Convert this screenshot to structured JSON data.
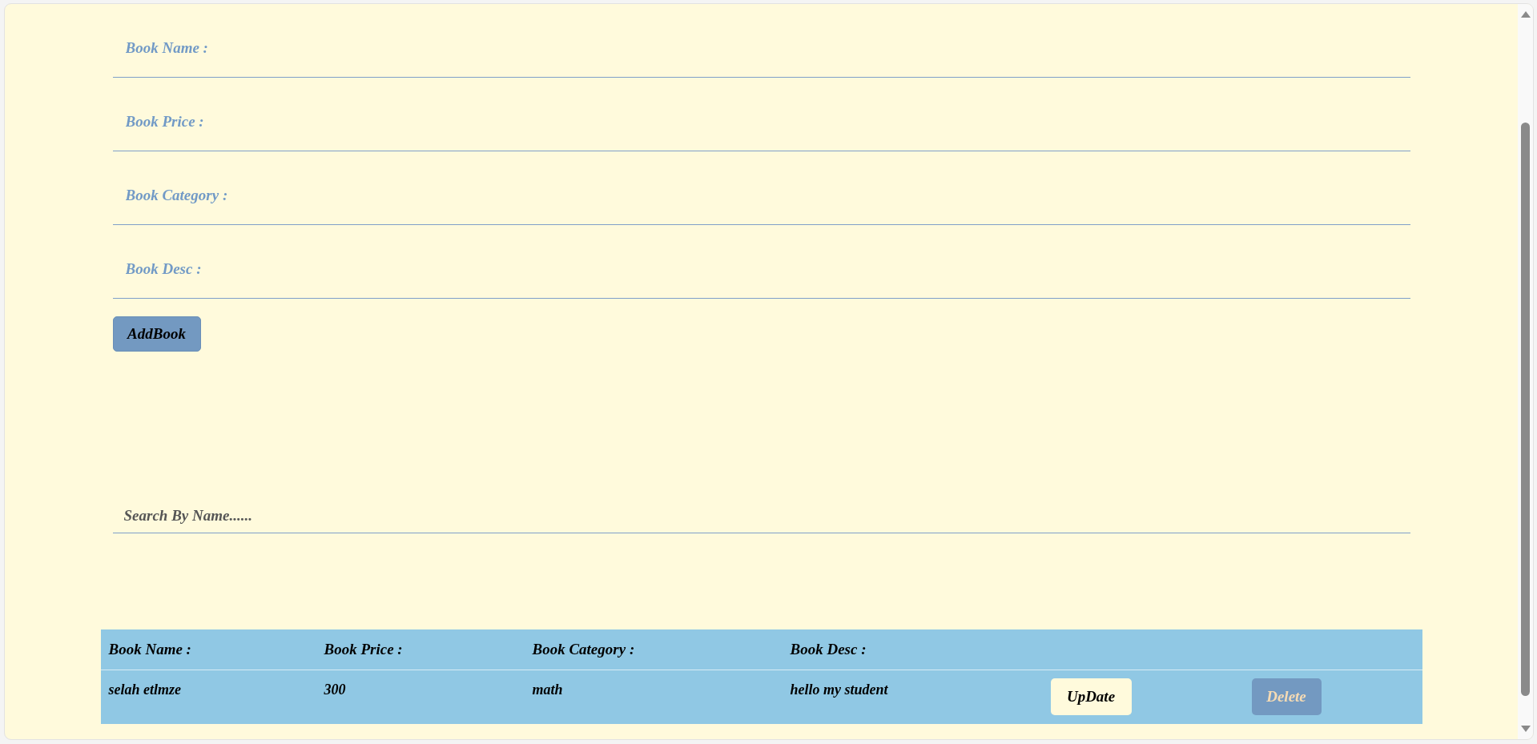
{
  "form": {
    "fields": [
      {
        "placeholder": "Book Name :"
      },
      {
        "placeholder": "Book Price :"
      },
      {
        "placeholder": "Book Category :"
      },
      {
        "placeholder": "Book Desc :"
      }
    ],
    "submit_button": "AddBook"
  },
  "search": {
    "placeholder": "Search By Name......"
  },
  "table": {
    "columns": [
      "Book Name :",
      "Book Price :",
      "Book Category :",
      "Book Desc :"
    ],
    "rows": [
      {
        "cells": [
          "selah etlmze",
          "300",
          "math",
          "hello my student"
        ],
        "actions": [
          {
            "kind": "update",
            "label": "UpDate"
          },
          {
            "kind": "delete",
            "label": "Delete"
          }
        ]
      }
    ]
  }
}
